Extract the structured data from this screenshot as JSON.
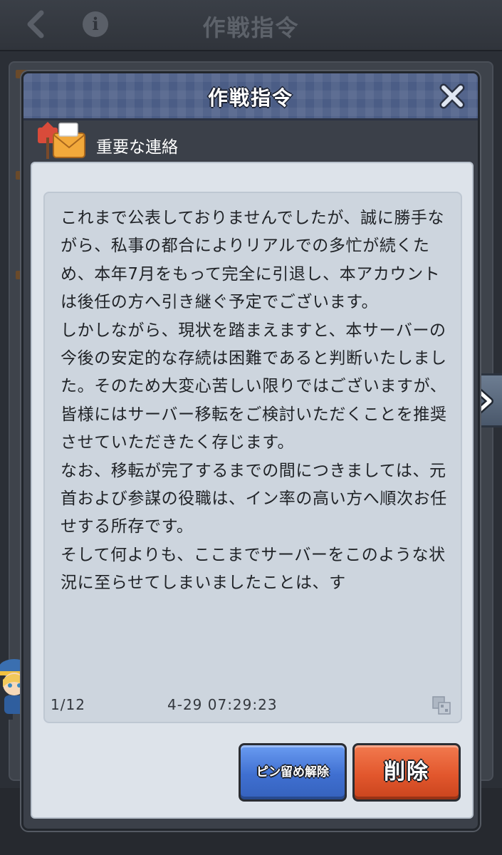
{
  "background": {
    "header_title": "作戦指令",
    "back_icon": "chevron-left-icon",
    "info_icon": "info-icon",
    "info_glyph": "i"
  },
  "dialog": {
    "title": "作戦指令",
    "close_icon": "close-icon",
    "mail_icon": "mail-icon",
    "subject": "重要な連絡",
    "body": "これまで公表しておりませんでしたが、誠に勝手ながら、私事の都合によりリアルでの多忙が続くため、本年7月をもって完全に引退し、本アカウントは後任の方へ引き継ぐ予定でございます。\nしかしながら、現状を踏まえますと、本サーバーの今後の安定的な存続は困難であると判断いたしました。そのため大変心苦しい限りではございますが、皆様にはサーバー移転をご検討いただくことを推奨させていただきたく存じます。\nなお、移転が完了するまでの間につきましては、元首および参謀の役職は、イン率の高い方へ順次お任せする所存です。\nそして何よりも、ここまでサーバーをこのような状況に至らせてしまいましたことは、す",
    "page_indicator": "1/12",
    "timestamp": "4-29 07:29:23",
    "copy_icon": "copy-icon",
    "unpin_label": "ピン留め解除",
    "delete_label": "削除"
  },
  "side_next_icon": "chevron-right-icon",
  "colors": {
    "header_blue": "#4b5d86",
    "unpin_blue": "#3f6fd0",
    "delete_red": "#e2572d",
    "panel_bg": "#dde3ea"
  }
}
